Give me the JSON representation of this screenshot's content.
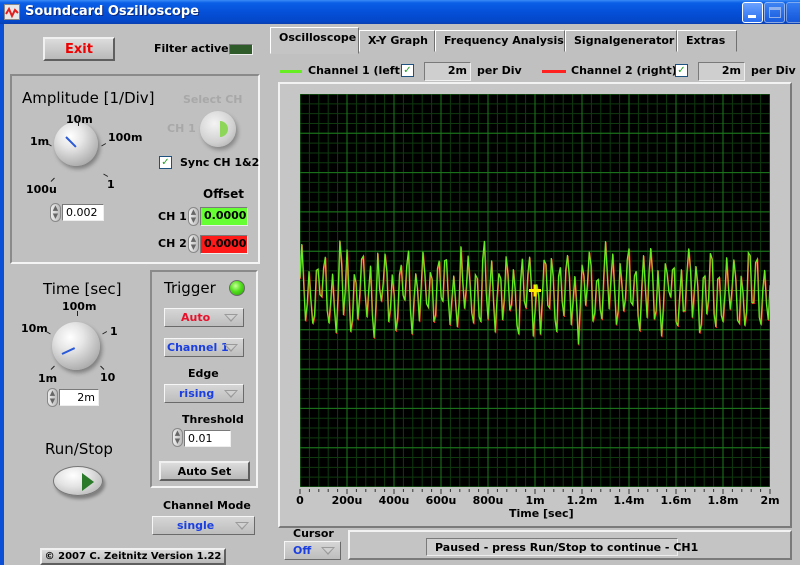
{
  "window": {
    "title": "Soundcard Oszilloscope",
    "buttons": [
      "minimize",
      "maximize",
      "close"
    ]
  },
  "left_panel": {
    "exit_label": "Exit",
    "filter_active_label": "Filter active",
    "amplitude": {
      "title": "Amplitude [1/Div]",
      "knob_labels": [
        "100u",
        "1m",
        "10m",
        "100m",
        "1"
      ],
      "value": "0.002"
    },
    "select_ch": {
      "title": "Select CH",
      "value_label": "CH 1"
    },
    "sync_label": "Sync CH 1&2",
    "sync_checked": true,
    "offset": {
      "title": "Offset",
      "ch1_label": "CH 1",
      "ch1_value": "0.0000",
      "ch1_color": "#66ff33",
      "ch2_label": "CH 2",
      "ch2_value": "0.0000",
      "ch2_color": "#ff1a1a"
    },
    "time": {
      "title": "Time [sec]",
      "knob_labels": [
        "1m",
        "10m",
        "100m",
        "1",
        "10"
      ],
      "value": "2m"
    },
    "run_stop_label": "Run/Stop",
    "trigger": {
      "title": "Trigger",
      "mode": "Auto",
      "channel": "Channel 1",
      "edge_label": "Edge",
      "edge": "rising",
      "threshold_label": "Threshold",
      "threshold": "0.01",
      "auto_set_label": "Auto Set"
    },
    "channel_mode": {
      "label": "Channel Mode",
      "value": "single"
    },
    "copyright": "© 2007   C. Zeitnitz Version 1.22"
  },
  "tabs": [
    {
      "label": "Oscilloscope",
      "active": true
    },
    {
      "label": "X-Y Graph",
      "active": false
    },
    {
      "label": "Frequency Analysis",
      "active": false
    },
    {
      "label": "Signalgenerator",
      "active": false
    },
    {
      "label": "Extras",
      "active": false
    }
  ],
  "channels": {
    "ch1": {
      "label": "Channel 1 (left)",
      "checked": true,
      "per_div": "2m",
      "per_div_label": "per Div",
      "color": "#66ee22"
    },
    "ch2": {
      "label": "Channel 2 (right)",
      "checked": true,
      "per_div": "2m",
      "per_div_label": "per Div",
      "color": "#ff2020"
    }
  },
  "cursor": {
    "label": "Cursor",
    "value": "Off"
  },
  "status": "Paused - press Run/Stop to continue - CH1",
  "chart_data": {
    "type": "line",
    "title": "",
    "xlabel": "Time [sec]",
    "ylabel": "",
    "xlim": [
      0,
      0.002
    ],
    "ylim": [
      -5,
      5
    ],
    "x_tick_labels": [
      "0",
      "200u",
      "400u",
      "600u",
      "800u",
      "1m",
      "1.2m",
      "1.4m",
      "1.6m",
      "1.8m",
      "2m"
    ],
    "grid": true,
    "legend": "top",
    "series": [
      {
        "name": "Channel 1 (left)",
        "color": "#66ee22",
        "description": "noisy oscillating signal centered at 0, amplitude approx ±1 div"
      },
      {
        "name": "Channel 2 (right)",
        "color": "#ff2020",
        "description": "overlapping signal, mostly hidden under channel 1"
      }
    ],
    "cursor_marker": {
      "x": 0.001,
      "y": 0,
      "color": "#ffee00"
    }
  }
}
